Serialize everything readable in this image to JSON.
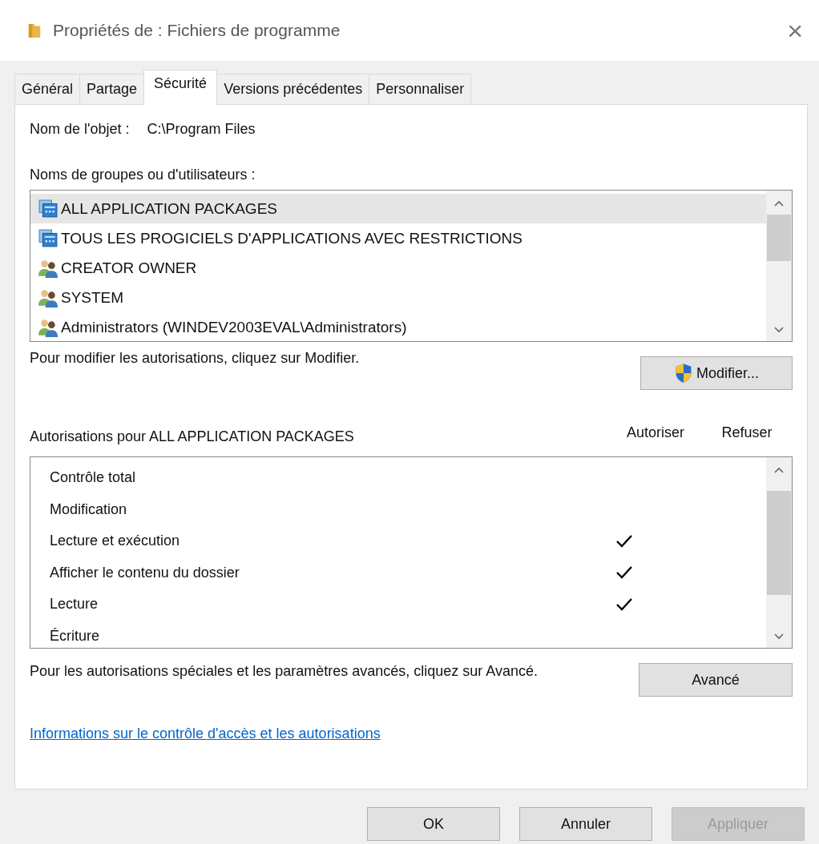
{
  "window": {
    "title": "Propriétés de : Fichiers de programme",
    "close": "×"
  },
  "tabs": [
    {
      "label": "Général",
      "selected": false
    },
    {
      "label": "Partage",
      "selected": false
    },
    {
      "label": "Sécurité",
      "selected": true
    },
    {
      "label": "Versions précédentes",
      "selected": false
    },
    {
      "label": "Personnaliser",
      "selected": false
    }
  ],
  "object_name": {
    "label": "Nom de l'objet :",
    "value": "C:\\Program Files"
  },
  "groups": {
    "label": "Noms de groupes ou d'utilisateurs :",
    "items": [
      {
        "name": "ALL APPLICATION PACKAGES",
        "kind": "package",
        "selected": true
      },
      {
        "name": "TOUS LES PROGICIELS D'APPLICATIONS AVEC RESTRICTIONS",
        "kind": "package",
        "selected": false
      },
      {
        "name": "CREATOR OWNER",
        "kind": "users",
        "selected": false
      },
      {
        "name": "SYSTEM",
        "kind": "users",
        "selected": false
      },
      {
        "name": "Administrators (WINDEV2003EVAL\\Administrators)",
        "kind": "users",
        "selected": false
      }
    ]
  },
  "modify_hint": "Pour modifier les autorisations, cliquez sur Modifier.",
  "modify_button": "Modifier...",
  "permissions": {
    "label": "Autorisations pour ALL APPLICATION PACKAGES",
    "allow_header": "Autoriser",
    "deny_header": "Refuser",
    "rows": [
      {
        "name": "Contrôle total",
        "allow": false
      },
      {
        "name": "Modification",
        "allow": false
      },
      {
        "name": "Lecture et exécution",
        "allow": true
      },
      {
        "name": "Afficher le contenu du dossier",
        "allow": true
      },
      {
        "name": "Lecture",
        "allow": true
      },
      {
        "name": "Écriture",
        "allow": false
      }
    ]
  },
  "advanced_hint": "Pour les autorisations spéciales et les paramètres avancés, cliquez sur Avancé.",
  "advanced_button": "Avancé",
  "help_link": "Informations sur le contrôle d'accès et les autorisations",
  "buttons": [
    {
      "label": "OK",
      "disabled": false
    },
    {
      "label": "Annuler",
      "disabled": false
    },
    {
      "label": "Appliquer",
      "disabled": true
    }
  ]
}
